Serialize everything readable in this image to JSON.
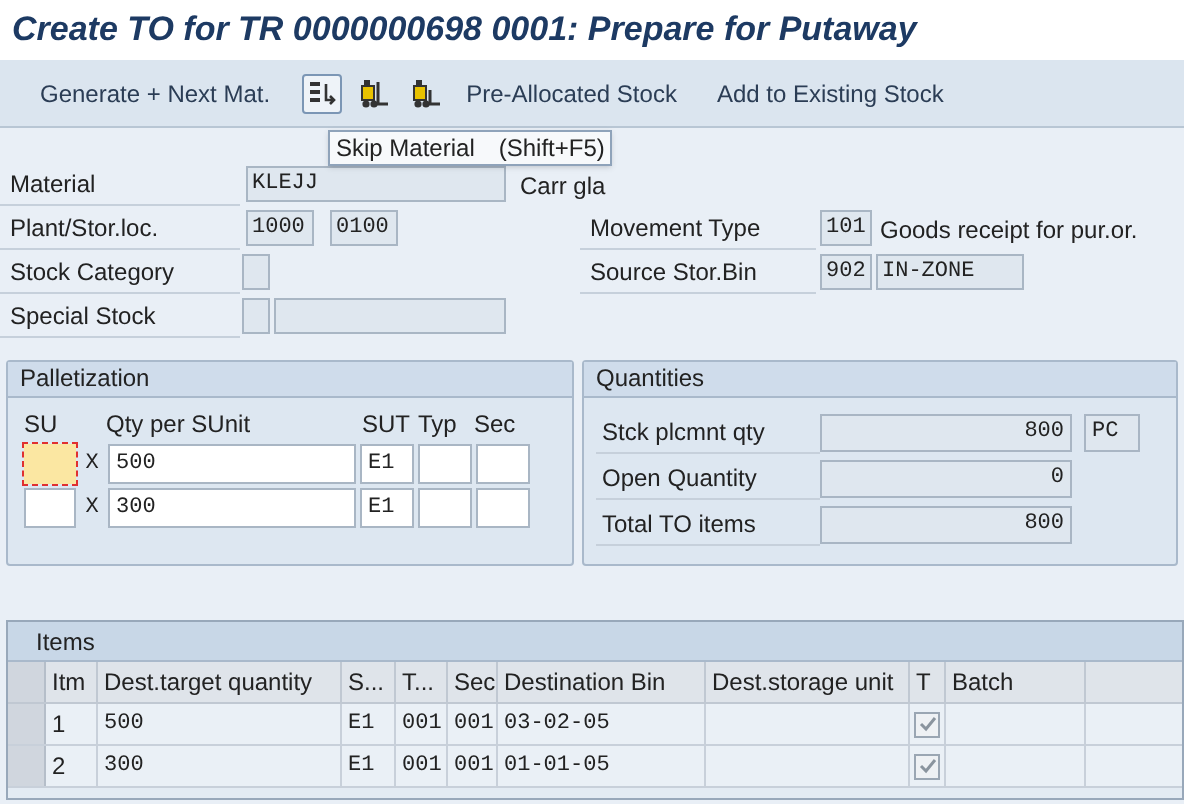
{
  "window": {
    "title": "Create TO for TR 0000000698 0001: Prepare for Putaway"
  },
  "toolbar": {
    "items": [
      {
        "kind": "text",
        "label": "Generate + Next Mat."
      },
      {
        "kind": "icon",
        "selected": true
      },
      {
        "kind": "icon",
        "selected": false
      },
      {
        "kind": "icon",
        "selected": false
      },
      {
        "kind": "text",
        "label": "Pre-Allocated Stock"
      },
      {
        "kind": "text",
        "label": "Add to Existing Stock"
      }
    ]
  },
  "tooltip": {
    "text": "Skip Material",
    "shortcut": "(Shift+F5)"
  },
  "header": {
    "material": {
      "label": "Material",
      "value": "KLEJJ",
      "description": "Carr gla"
    },
    "plant": {
      "label": "Plant/Stor.loc.",
      "plant": "1000",
      "storage_location": "0100"
    },
    "stock_category": {
      "label": "Stock Category"
    },
    "special_stock": {
      "label": "Special Stock"
    },
    "movement_type": {
      "label": "Movement Type",
      "value": "101",
      "description": "Goods receipt for pur.or."
    },
    "source_bin": {
      "label": "Source Stor.Bin",
      "value": "902",
      "description": "IN-ZONE"
    }
  },
  "palletization": {
    "title": "Palletization",
    "columns": [
      "SU",
      "Qty per SUnit",
      "SUT",
      "Typ",
      "Sec"
    ],
    "rows": [
      {
        "su": "",
        "x": "X",
        "qty": "500",
        "sut": "E1",
        "selected": true
      },
      {
        "su": "",
        "x": "X",
        "qty": "300",
        "sut": "E1",
        "selected": false
      }
    ]
  },
  "quantities": {
    "title": "Quantities",
    "rows": [
      {
        "label": "Stck plcmnt qty",
        "value": "800",
        "unit": "PC"
      },
      {
        "label": "Open Quantity",
        "value": "0"
      },
      {
        "label": "Total TO items",
        "value": "800"
      }
    ]
  },
  "items": {
    "title": "Items",
    "columns": [
      "Itm",
      "Dest.target quantity",
      "S...",
      "T...",
      "Sec",
      "Destination Bin",
      "Dest.storage unit",
      "T",
      "Batch"
    ],
    "rows": [
      {
        "itm": "1",
        "qty": "500",
        "s": "E1",
        "t": "001",
        "sec": "001",
        "bin": "03-02-05",
        "su": "",
        "checked": true,
        "batch": ""
      },
      {
        "itm": "2",
        "qty": "300",
        "s": "E1",
        "t": "001",
        "sec": "001",
        "bin": "01-01-05",
        "su": "",
        "checked": true,
        "batch": ""
      }
    ]
  }
}
